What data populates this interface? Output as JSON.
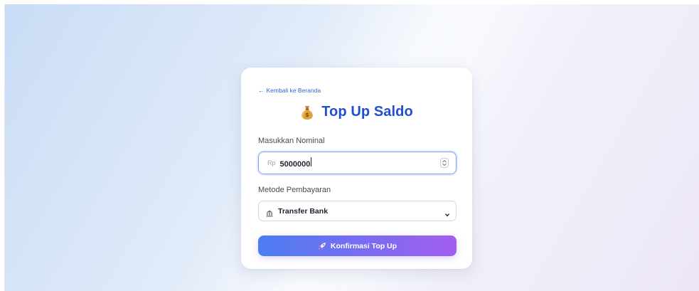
{
  "back_link": {
    "arrow": "←",
    "label": "Kembali ke Beranda"
  },
  "header": {
    "icon": "money-bag-icon",
    "title": "Top Up Saldo"
  },
  "amount": {
    "label": "Masukkan Nominal",
    "currency_prefix": "Rp",
    "value": "5000000",
    "stepper_icon": "stepper-icon"
  },
  "payment_method": {
    "label": "Metode Pembayaran",
    "selected": "Transfer Bank",
    "icon": "bank-icon",
    "chevron_icon": "chevron-down-icon"
  },
  "confirm_button": {
    "icon": "rocket-icon",
    "label": "Konfirmasi Top Up"
  },
  "colors": {
    "accent_blue": "#1f4fd0",
    "link_blue": "#2f64d8",
    "button_gradient_start": "#4c7df0",
    "button_gradient_end": "#a45ef0"
  }
}
